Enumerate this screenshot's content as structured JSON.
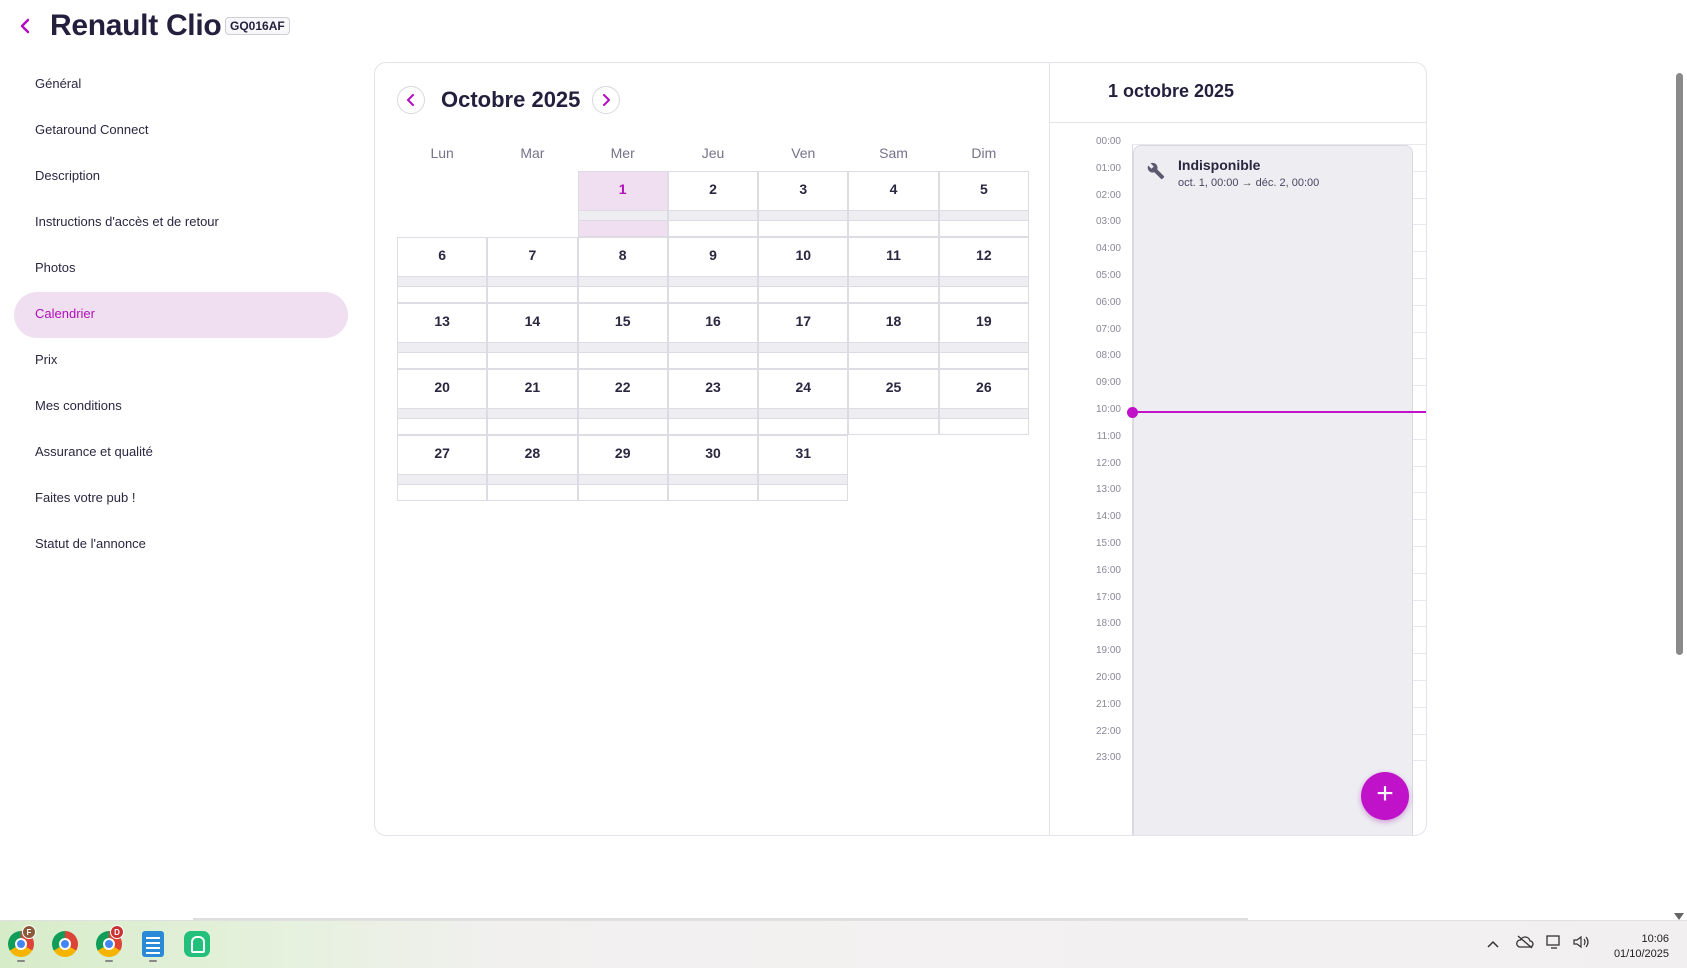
{
  "header": {
    "title": "Renault Clio",
    "plate": "GQ016AF"
  },
  "sidebar": {
    "items": [
      {
        "label": "Général",
        "active": false
      },
      {
        "label": "Getaround Connect",
        "active": false
      },
      {
        "label": "Description",
        "active": false
      },
      {
        "label": "Instructions d'accès et de retour",
        "active": false
      },
      {
        "label": "Photos",
        "active": false
      },
      {
        "label": "Calendrier",
        "active": true
      },
      {
        "label": "Prix",
        "active": false
      },
      {
        "label": "Mes conditions",
        "active": false
      },
      {
        "label": "Assurance et qualité",
        "active": false
      },
      {
        "label": "Faites votre pub !",
        "active": false
      },
      {
        "label": "Statut de l'annonce",
        "active": false
      }
    ]
  },
  "calendar": {
    "month_title": "Octobre 2025",
    "weekdays": [
      "Lun",
      "Mar",
      "Mer",
      "Jeu",
      "Ven",
      "Sam",
      "Dim"
    ],
    "first_day_column": 2,
    "days_in_month": 31,
    "today": 1
  },
  "day_view": {
    "title": "1 octobre 2025",
    "hours": [
      "00:00",
      "01:00",
      "02:00",
      "03:00",
      "04:00",
      "05:00",
      "06:00",
      "07:00",
      "08:00",
      "09:00",
      "10:00",
      "11:00",
      "12:00",
      "13:00",
      "14:00",
      "15:00",
      "16:00",
      "17:00",
      "18:00",
      "19:00",
      "20:00",
      "21:00",
      "22:00",
      "23:00"
    ],
    "now_hour": 10,
    "event": {
      "title": "Indisponible",
      "range": "oct. 1, 00:00 → déc. 2, 00:00",
      "icon": "wrench-icon"
    },
    "add_button": "+"
  },
  "taskbar": {
    "apps": [
      {
        "name": "chrome-icon",
        "badge": "F"
      },
      {
        "name": "chrome-icon",
        "badge": ""
      },
      {
        "name": "chrome-icon",
        "badge": "D"
      },
      {
        "name": "notepad-icon",
        "badge": ""
      },
      {
        "name": "getaround-icon",
        "badge": ""
      }
    ],
    "time": "10:06",
    "date": "01/10/2025"
  },
  "colors": {
    "accent": "#c012c8",
    "active_bg": "#f0dff0",
    "title": "#231f3d"
  }
}
